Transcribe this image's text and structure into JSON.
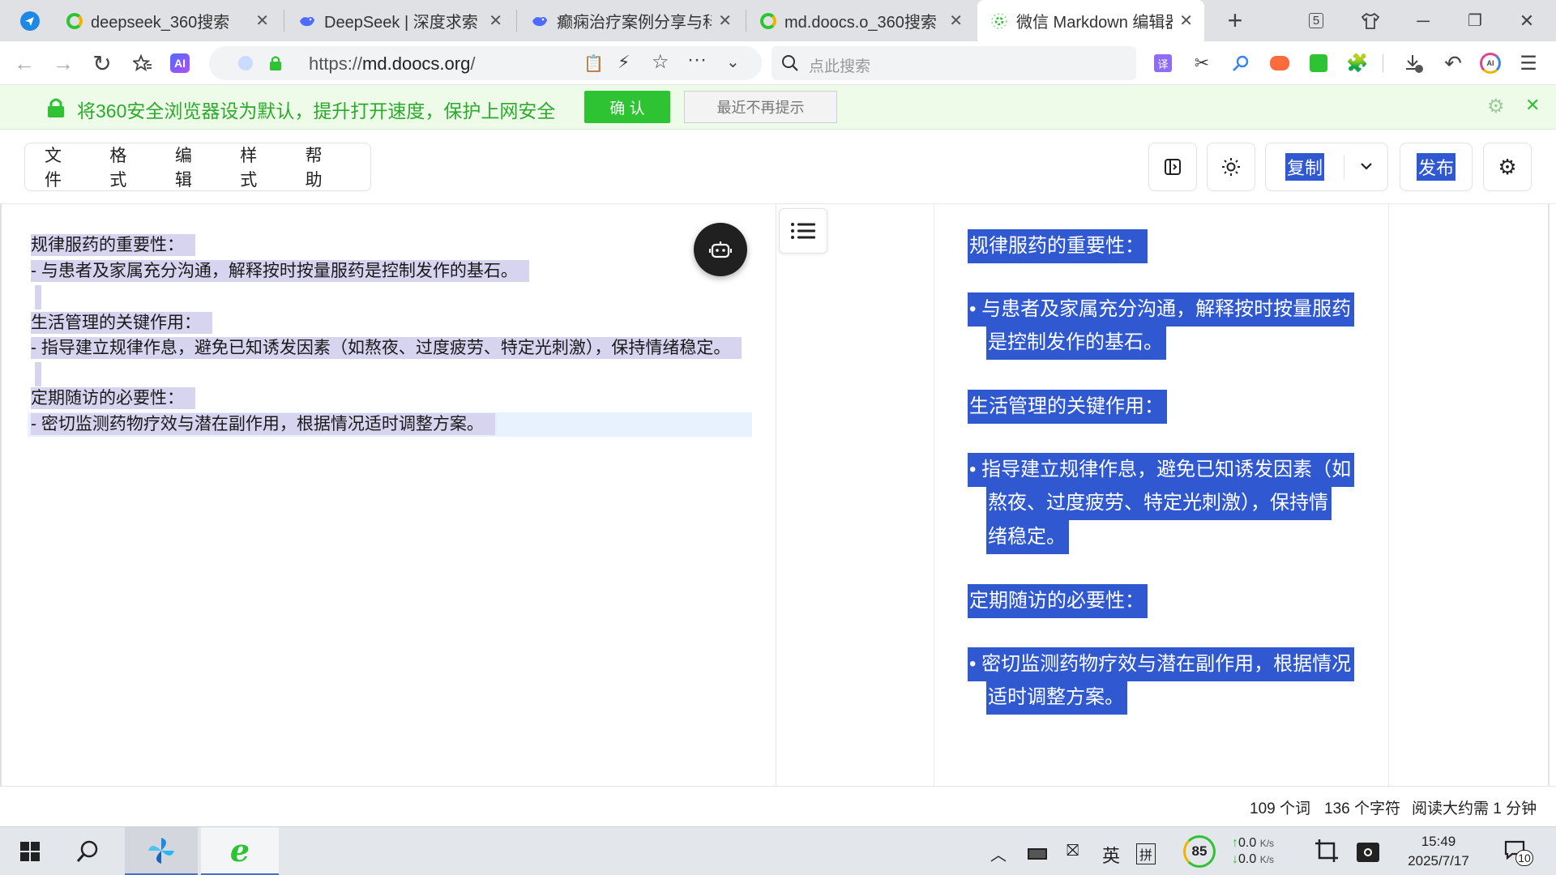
{
  "browser": {
    "tabs": [
      {
        "title": "deepseek_360搜索",
        "icon": "360-search-icon"
      },
      {
        "title": "DeepSeek | 深度求索",
        "icon": "deepseek-icon"
      },
      {
        "title": "癫痫治疗案例分享与科普",
        "icon": "deepseek-icon"
      },
      {
        "title": "md.doocs.o_360搜索",
        "icon": "360-search-icon"
      },
      {
        "title": "微信 Markdown 编辑器",
        "icon": "doocs-icon"
      }
    ],
    "tab_count": "5",
    "url_prefix": "https://",
    "url_domain": "md.doocs.org",
    "url_suffix": "/",
    "search_placeholder": "点此搜索"
  },
  "notice": {
    "message": "将360安全浏览器设为默认，提升打开速度，保护上网安全",
    "confirm_label": "确 认",
    "dismiss_label": "最近不再提示"
  },
  "editor": {
    "menu": [
      "文件",
      "格式",
      "编辑",
      "样式",
      "帮助"
    ],
    "copy_label": "复制",
    "publish_label": "发布",
    "source_lines": [
      "规律服药的重要性：",
      "- 与患者及家属充分沟通，解释按时按量服药是控制发作的基石。",
      "生活管理的关键作用：",
      "- 指导建立规律作息，避免已知诱发因素（如熬夜、过度疲劳、特定光刺激），保持情绪稳定。",
      "定期随访的必要性：",
      "- 密切监测药物疗效与潜在副作用，根据情况适时调整方案。"
    ],
    "preview": {
      "h1": "规律服药的重要性：",
      "li1_a": "• 与患者及家属充分沟通，解释按时按量服药",
      "li1_b": "是控制发作的基石。",
      "h2": "生活管理的关键作用：",
      "li2_a": "• 指导建立规律作息，避免已知诱发因素（如",
      "li2_b": "熬夜、过度疲劳、特定光刺激），保持情",
      "li2_c": "绪稳定。",
      "h3": "定期随访的必要性：",
      "li3_a": "• 密切监测药物疗效与潜在副作用，根据情况",
      "li3_b": "适时调整方案。"
    },
    "status": {
      "words": "109 个词",
      "chars": "136 个字符",
      "read_time": "阅读大约需 1 分钟"
    }
  },
  "taskbar": {
    "ime_lang": "英",
    "ime_mode": "拼",
    "cpu_score": "85",
    "net_up": "0.0",
    "net_down": "0.0",
    "net_unit": "K/s",
    "time": "15:49",
    "date": "2025/7/17",
    "notifications": "10"
  },
  "colors": {
    "selection": "#2f58d1",
    "source_highlight": "#d7d4f0",
    "notice_green": "#2ec332"
  }
}
